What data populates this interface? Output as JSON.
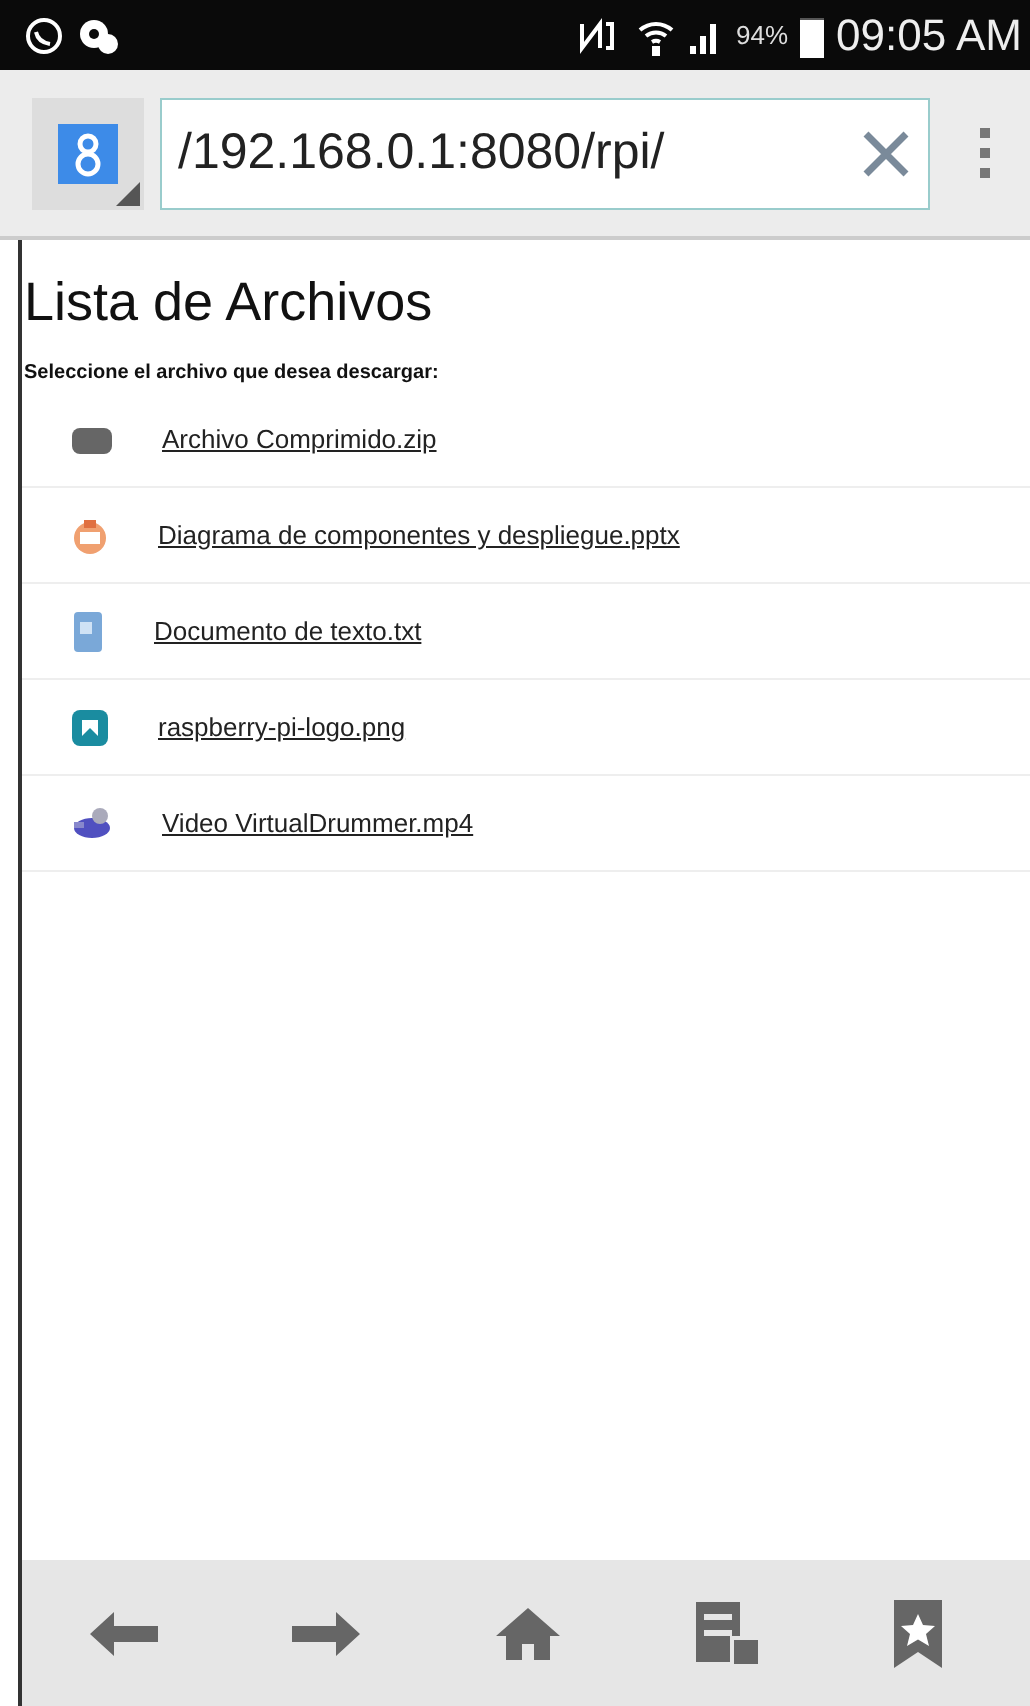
{
  "status_bar": {
    "battery_text": "94%",
    "time": "09:05 AM"
  },
  "toolbar": {
    "url": "/192.168.0.1:8080/rpi/"
  },
  "page": {
    "title": "Lista de Archivos",
    "instruction": "Seleccione el archivo que desea descargar:",
    "files": [
      {
        "name": "Archivo Comprimido.zip",
        "kind": "zip"
      },
      {
        "name": "Diagrama de componentes y despliegue.pptx",
        "kind": "pptx"
      },
      {
        "name": "Documento de texto.txt",
        "kind": "txt"
      },
      {
        "name": "raspberry-pi-logo.png",
        "kind": "png"
      },
      {
        "name": "Video VirtualDrummer.mp4",
        "kind": "mp4"
      }
    ]
  }
}
